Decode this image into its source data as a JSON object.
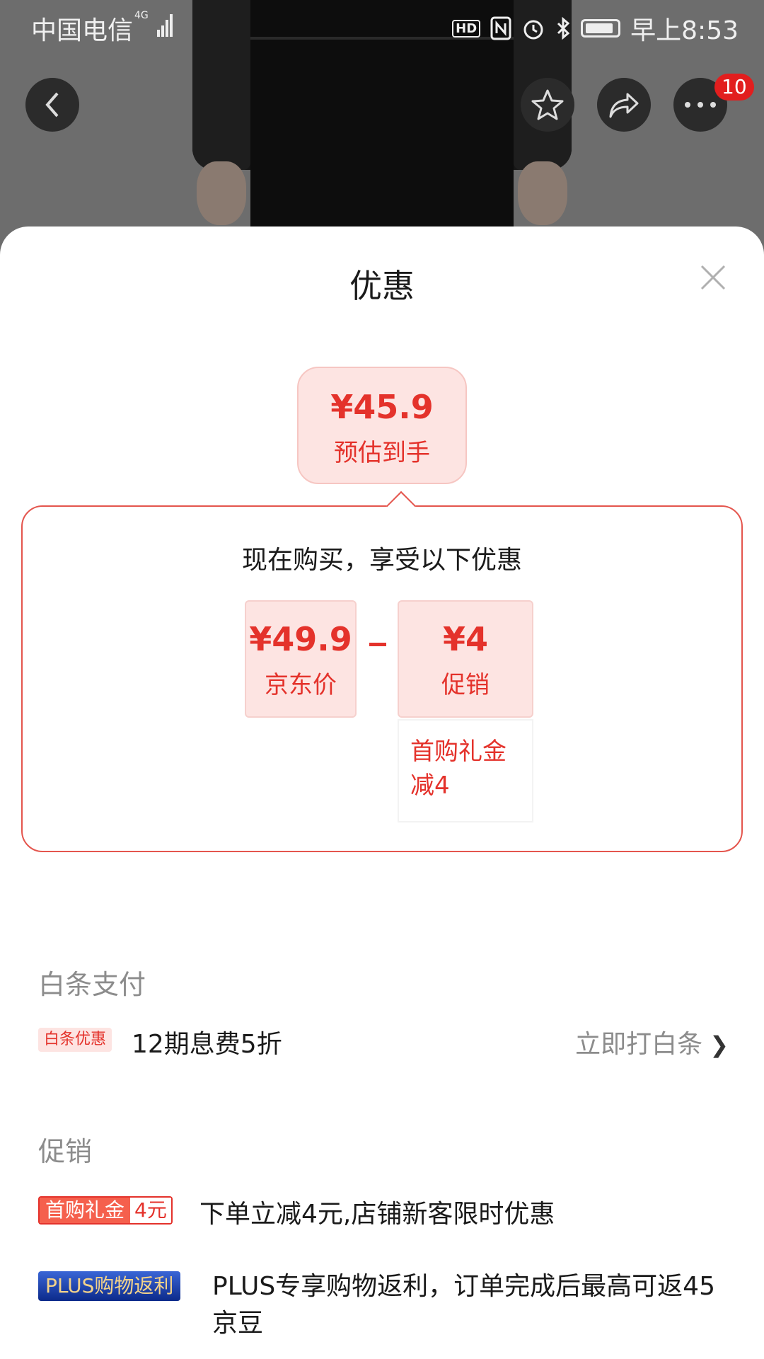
{
  "status_bar": {
    "carrier": "中国电信",
    "network": "4G",
    "time": "早上8:53",
    "hd": "HD"
  },
  "header": {
    "more_badge": "10"
  },
  "sheet": {
    "title": "优惠",
    "estimate": {
      "price": "¥45.9",
      "label": "预估到手"
    },
    "breakdown": {
      "heading": "现在购买，享受以下优惠",
      "jd_price": {
        "price": "¥49.9",
        "label": "京东价"
      },
      "promo": {
        "price": "¥4",
        "label": "促销"
      },
      "promo_detail": "首购礼金减4"
    },
    "baitiao": {
      "section_title": "白条支付",
      "tag": "白条优惠",
      "text": "12期息费5折",
      "action": "立即打白条"
    },
    "promotion": {
      "section_title": "促销",
      "first_purchase_tag_a": "首购礼金",
      "first_purchase_tag_b": "4元",
      "first_purchase_text": "下单立减4元,店铺新客限时优惠",
      "plus_tag": "PLUS购物返利",
      "plus_text": "PLUS专享购物返利，订单完成后最高可返45京豆"
    }
  },
  "colors": {
    "accent_red": "#e4322b",
    "pink_bg": "#fde4e2"
  }
}
